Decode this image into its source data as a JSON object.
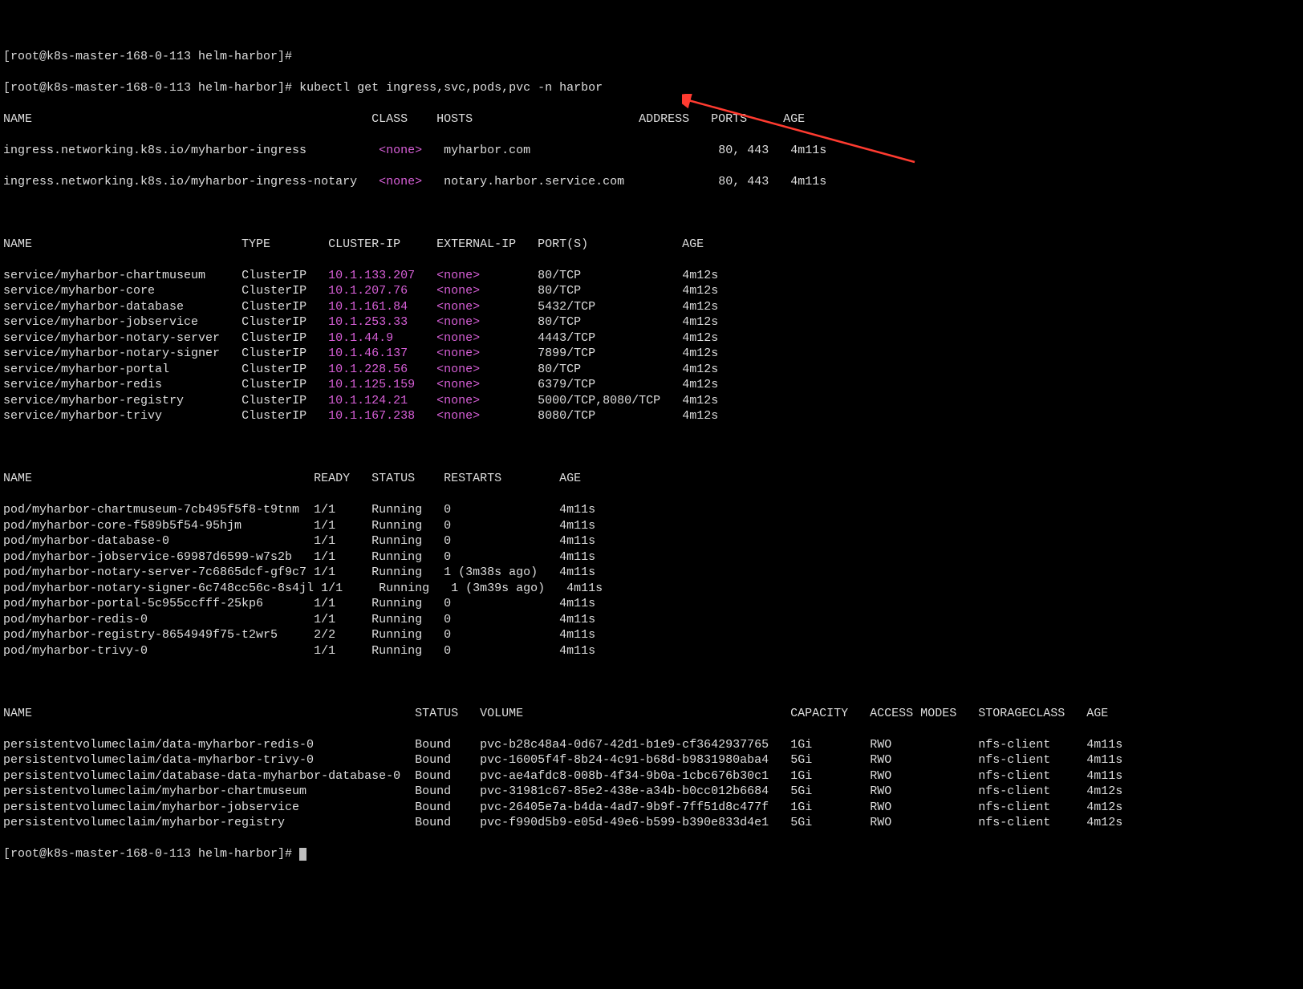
{
  "prompt": {
    "p1": "[root@k8s-master-168-0-113 helm-harbor]#",
    "p2": "[root@k8s-master-168-0-113 helm-harbor]# ",
    "cmd": "kubectl get ingress,svc,pods,pvc -n harbor",
    "p3": "[root@k8s-master-168-0-113 helm-harbor]# "
  },
  "ingress": {
    "header": "NAME                                               CLASS    HOSTS                       ADDRESS   PORTS     AGE",
    "spacerA": "          ",
    "spacerA2": "   ",
    "spacerB": "   ",
    "spacerD": "   ",
    "rows": [
      {
        "name": "ingress.networking.k8s.io/myharbor-ingress",
        "class": "<none>",
        "host": "myharbor.com",
        "spC": "                          ",
        "ports": "80, 443",
        "age": "4m11s"
      },
      {
        "name": "ingress.networking.k8s.io/myharbor-ingress-notary",
        "class": "<none>",
        "host": "notary.harbor.service.com",
        "spC": "             ",
        "ports": "80, 443",
        "age": "4m11s"
      }
    ]
  },
  "svc": {
    "header": "NAME                             TYPE        CLUSTER-IP     EXTERNAL-IP   PORT(S)             AGE",
    "rows": [
      {
        "name": "service/myharbor-chartmuseum",
        "type": "ClusterIP",
        "ip": "10.1.133.207",
        "ext": "<none>",
        "ports": "80/TCP",
        "age": "4m12s"
      },
      {
        "name": "service/myharbor-core",
        "type": "ClusterIP",
        "ip": "10.1.207.76",
        "ext": "<none>",
        "ports": "80/TCP",
        "age": "4m12s"
      },
      {
        "name": "service/myharbor-database",
        "type": "ClusterIP",
        "ip": "10.1.161.84",
        "ext": "<none>",
        "ports": "5432/TCP",
        "age": "4m12s"
      },
      {
        "name": "service/myharbor-jobservice",
        "type": "ClusterIP",
        "ip": "10.1.253.33",
        "ext": "<none>",
        "ports": "80/TCP",
        "age": "4m12s"
      },
      {
        "name": "service/myharbor-notary-server",
        "type": "ClusterIP",
        "ip": "10.1.44.9",
        "ext": "<none>",
        "ports": "4443/TCP",
        "age": "4m12s"
      },
      {
        "name": "service/myharbor-notary-signer",
        "type": "ClusterIP",
        "ip": "10.1.46.137",
        "ext": "<none>",
        "ports": "7899/TCP",
        "age": "4m12s"
      },
      {
        "name": "service/myharbor-portal",
        "type": "ClusterIP",
        "ip": "10.1.228.56",
        "ext": "<none>",
        "ports": "80/TCP",
        "age": "4m12s"
      },
      {
        "name": "service/myharbor-redis",
        "type": "ClusterIP",
        "ip": "10.1.125.159",
        "ext": "<none>",
        "ports": "6379/TCP",
        "age": "4m12s"
      },
      {
        "name": "service/myharbor-registry",
        "type": "ClusterIP",
        "ip": "10.1.124.21",
        "ext": "<none>",
        "ports": "5000/TCP,8080/TCP",
        "age": "4m12s"
      },
      {
        "name": "service/myharbor-trivy",
        "type": "ClusterIP",
        "ip": "10.1.167.238",
        "ext": "<none>",
        "ports": "8080/TCP",
        "age": "4m12s"
      }
    ]
  },
  "pods": {
    "header": "NAME                                       READY   STATUS    RESTARTS        AGE",
    "rows": [
      {
        "name": "pod/myharbor-chartmuseum-7cb495f5f8-t9tnm",
        "ready": "1/1",
        "status": "Running",
        "restarts": "0",
        "age": "4m11s"
      },
      {
        "name": "pod/myharbor-core-f589b5f54-95hjm",
        "ready": "1/1",
        "status": "Running",
        "restarts": "0",
        "age": "4m11s"
      },
      {
        "name": "pod/myharbor-database-0",
        "ready": "1/1",
        "status": "Running",
        "restarts": "0",
        "age": "4m11s"
      },
      {
        "name": "pod/myharbor-jobservice-69987d6599-w7s2b",
        "ready": "1/1",
        "status": "Running",
        "restarts": "0",
        "age": "4m11s"
      },
      {
        "name": "pod/myharbor-notary-server-7c6865dcf-gf9c7",
        "ready": "1/1",
        "status": "Running",
        "restarts": "1 (3m38s ago)",
        "age": "4m11s"
      },
      {
        "name": "pod/myharbor-notary-signer-6c748cc56c-8s4jl",
        "ready": "1/1",
        "status": "Running",
        "restarts": "1 (3m39s ago)",
        "age": "4m11s"
      },
      {
        "name": "pod/myharbor-portal-5c955ccfff-25kp6",
        "ready": "1/1",
        "status": "Running",
        "restarts": "0",
        "age": "4m11s"
      },
      {
        "name": "pod/myharbor-redis-0",
        "ready": "1/1",
        "status": "Running",
        "restarts": "0",
        "age": "4m11s"
      },
      {
        "name": "pod/myharbor-registry-8654949f75-t2wr5",
        "ready": "2/2",
        "status": "Running",
        "restarts": "0",
        "age": "4m11s"
      },
      {
        "name": "pod/myharbor-trivy-0",
        "ready": "1/1",
        "status": "Running",
        "restarts": "0",
        "age": "4m11s"
      }
    ]
  },
  "pvc": {
    "header": "NAME                                                     STATUS   VOLUME                                     CAPACITY   ACCESS MODES   STORAGECLASS   AGE",
    "rows": [
      {
        "name": "persistentvolumeclaim/data-myharbor-redis-0",
        "status": "Bound",
        "vol": "pvc-b28c48a4-0d67-42d1-b1e9-cf3642937765",
        "cap": "1Gi",
        "am": "RWO",
        "sc": "nfs-client",
        "age": "4m11s"
      },
      {
        "name": "persistentvolumeclaim/data-myharbor-trivy-0",
        "status": "Bound",
        "vol": "pvc-16005f4f-8b24-4c91-b68d-b9831980aba4",
        "cap": "5Gi",
        "am": "RWO",
        "sc": "nfs-client",
        "age": "4m11s"
      },
      {
        "name": "persistentvolumeclaim/database-data-myharbor-database-0",
        "status": "Bound",
        "vol": "pvc-ae4afdc8-008b-4f34-9b0a-1cbc676b30c1",
        "cap": "1Gi",
        "am": "RWO",
        "sc": "nfs-client",
        "age": "4m11s"
      },
      {
        "name": "persistentvolumeclaim/myharbor-chartmuseum",
        "status": "Bound",
        "vol": "pvc-31981c67-85e2-438e-a34b-b0cc012b6684",
        "cap": "5Gi",
        "am": "RWO",
        "sc": "nfs-client",
        "age": "4m12s"
      },
      {
        "name": "persistentvolumeclaim/myharbor-jobservice",
        "status": "Bound",
        "vol": "pvc-26405e7a-b4da-4ad7-9b9f-7ff51d8c477f",
        "cap": "1Gi",
        "am": "RWO",
        "sc": "nfs-client",
        "age": "4m12s"
      },
      {
        "name": "persistentvolumeclaim/myharbor-registry",
        "status": "Bound",
        "vol": "pvc-f990d5b9-e05d-49e6-b599-b390e833d4e1",
        "cap": "5Gi",
        "am": "RWO",
        "sc": "nfs-client",
        "age": "4m12s"
      }
    ]
  }
}
